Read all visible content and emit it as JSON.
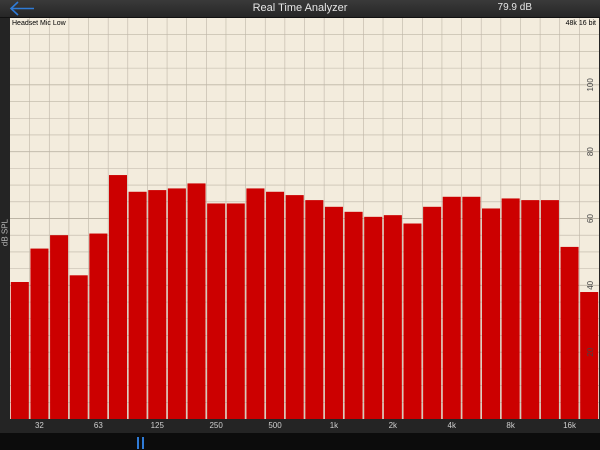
{
  "header": {
    "title": "Real Time Analyzer",
    "level_readout": "79.9 dB"
  },
  "plot": {
    "input_label": "Headset Mic Low",
    "format_label": "48k 16 bit",
    "y_axis_label": "dB SPL"
  },
  "colors": {
    "bar": "#cc0000",
    "background": "#f3ecdd",
    "grid": "#bdb5a6",
    "accent": "#2f7bd6"
  },
  "icons": {
    "back": "left-arrow-icon",
    "pause": "pause-icon"
  },
  "chart_data": {
    "type": "bar",
    "ylabel": "dB SPL",
    "ylim": [
      0,
      120
    ],
    "y_ticks": [
      20,
      40,
      60,
      80,
      100
    ],
    "x_tick_labels": [
      "32",
      "63",
      "125",
      "250",
      "500",
      "1k",
      "2k",
      "4k",
      "8k",
      "16k"
    ],
    "grid": true,
    "values": [
      41,
      51,
      55,
      43,
      55.5,
      73,
      68,
      68.5,
      69,
      70.5,
      64.5,
      64.5,
      69,
      68,
      67,
      65.5,
      63.5,
      62,
      60.5,
      61,
      58.5,
      63.5,
      66.5,
      66.5,
      63,
      66,
      65.5,
      65.5,
      51.5,
      38
    ]
  }
}
